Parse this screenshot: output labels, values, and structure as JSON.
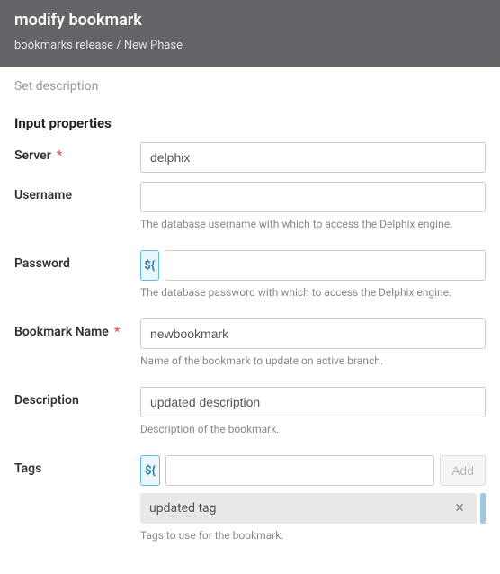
{
  "header": {
    "title": "modify bookmark",
    "breadcrumb": "bookmarks release / New Phase"
  },
  "descriptionPlaceholder": "Set description",
  "sectionTitle": "Input properties",
  "fields": {
    "server": {
      "label": "Server",
      "value": "delphix"
    },
    "username": {
      "label": "Username",
      "value": "",
      "help": "The database username with which to access the Delphix engine."
    },
    "password": {
      "label": "Password",
      "value": "",
      "varToggle": "${",
      "help": "The database password with which to access the Delphix engine."
    },
    "bookmarkName": {
      "label": "Bookmark Name",
      "value": "newbookmark",
      "help": "Name of the bookmark to update on active branch."
    },
    "description": {
      "label": "Description",
      "value": "updated description",
      "help": "Description of the bookmark."
    },
    "tags": {
      "label": "Tags",
      "varToggle": "${",
      "addLabel": "Add",
      "pill": "updated tag",
      "help": "Tags to use for the bookmark."
    }
  }
}
